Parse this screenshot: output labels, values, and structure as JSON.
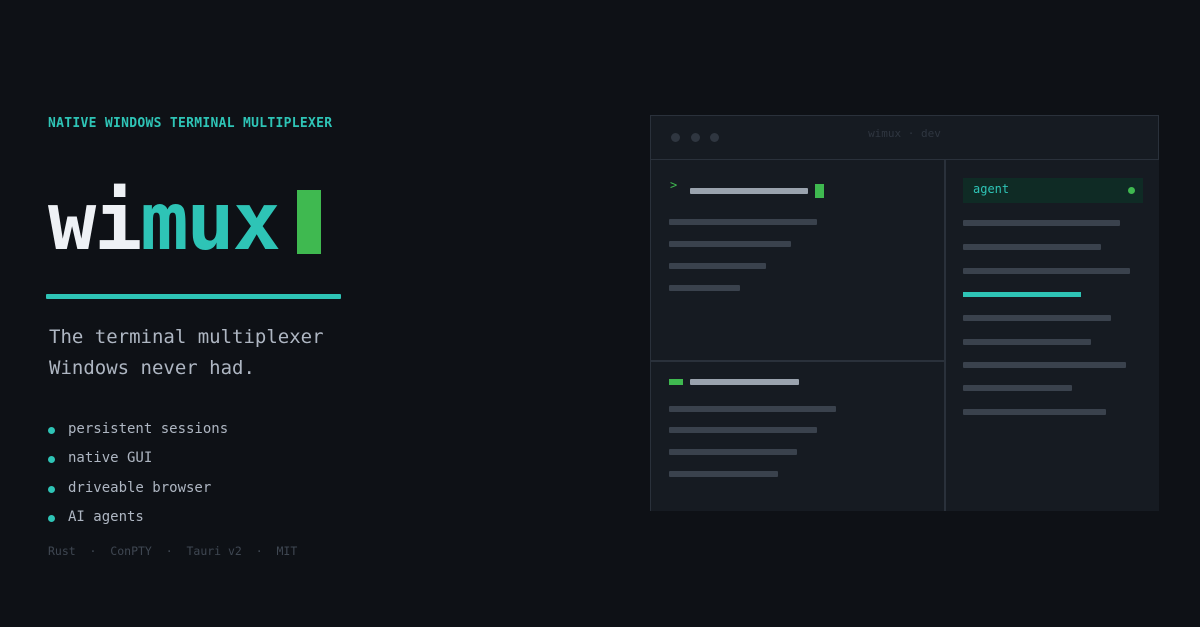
{
  "hero": {
    "tagline": "NATIVE WINDOWS TERMINAL MULTIPLEXER",
    "logo_part1": "wi",
    "logo_part2": "mux",
    "headline_line1": "The terminal multiplexer",
    "headline_line2": "Windows never had.",
    "features": [
      "persistent sessions",
      "native GUI",
      "driveable browser",
      "AI agents"
    ],
    "stack": "Rust  ·  ConPTY  ·  Tauri v2  ·  MIT"
  },
  "window": {
    "title": "wimux · dev",
    "prompt_symbol": ">",
    "agent_label": "agent"
  },
  "colors": {
    "background": "#0e1116",
    "accent_teal": "#2ec4b6",
    "accent_green": "#3fb950",
    "text_muted": "#aeb6c2"
  }
}
